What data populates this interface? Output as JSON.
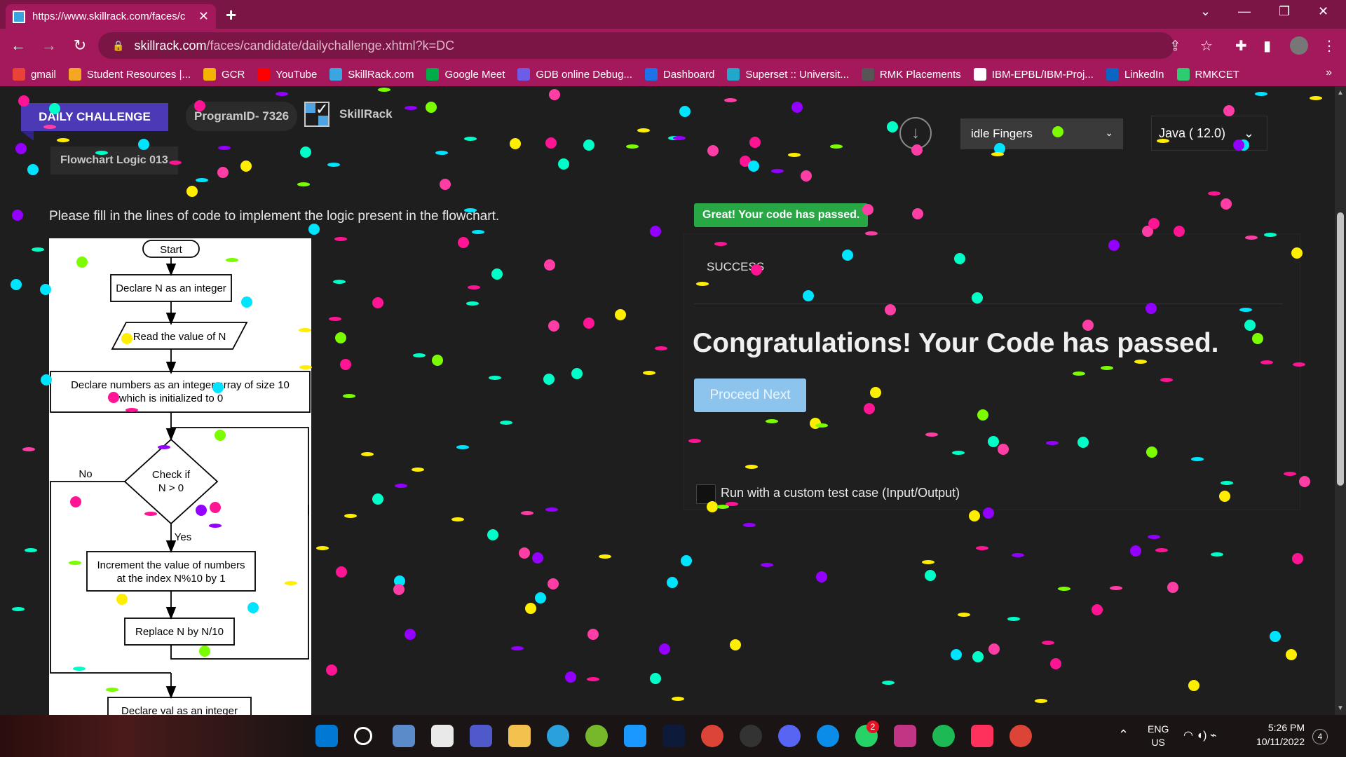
{
  "browser": {
    "tab_title": "https://www.skillrack.com/faces/c",
    "url_host": "skillrack.com",
    "url_path": "/faces/candidate/dailychallenge.xhtml?k=DC",
    "bookmarks": [
      {
        "label": "gmail",
        "icon": "gmail-icon",
        "color": "#ea4335"
      },
      {
        "label": "Student Resources |...",
        "icon": "student-resources-icon",
        "color": "#f5a623"
      },
      {
        "label": "GCR",
        "icon": "classroom-icon",
        "color": "#f4b400"
      },
      {
        "label": "YouTube",
        "icon": "youtube-icon",
        "color": "#ff0000"
      },
      {
        "label": "SkillRack.com",
        "icon": "skillrack-icon",
        "color": "#3aa6e0"
      },
      {
        "label": "Google Meet",
        "icon": "meet-icon",
        "color": "#00ac47"
      },
      {
        "label": "GDB online Debug...",
        "icon": "gdb-icon",
        "color": "#6c5ce7"
      },
      {
        "label": "Dashboard",
        "icon": "dashboard-icon",
        "color": "#1a73e8"
      },
      {
        "label": "Superset :: Universit...",
        "icon": "superset-icon",
        "color": "#20a7c9"
      },
      {
        "label": "RMK Placements",
        "icon": "rmk-icon",
        "color": "#555555"
      },
      {
        "label": "IBM-EPBL/IBM-Proj...",
        "icon": "github-icon",
        "color": "#ffffff"
      },
      {
        "label": "LinkedIn",
        "icon": "linkedin-icon",
        "color": "#0a66c2"
      },
      {
        "label": "RMKCET",
        "icon": "rmkcet-icon",
        "color": "#2ecc71"
      }
    ],
    "more": "»"
  },
  "header": {
    "badge": "DAILY CHALLENGE",
    "program_id": "ProgramID- 7326",
    "logo_text": "SkillRack",
    "subtitle": "Flowchart Logic 013"
  },
  "instructions": "Please fill in the lines of code to implement the logic present in the flowchart.",
  "flowchart": {
    "start": "Start",
    "step1": "Declare N as an integer",
    "step2": "Read the value of N",
    "step3_line1": "Declare numbers as an integer array of size 10",
    "step3_line2": "which is initialized to 0",
    "decision_line1": "Check if",
    "decision_line2": "N > 0",
    "no_label": "No",
    "yes_label": "Yes",
    "step4_line1": "Increment the value of numbers",
    "step4_line2": "at the index N%10 by 1",
    "step5": "Replace N by N/10",
    "step6": "Declare val as an integer"
  },
  "controls": {
    "theme": "idle Fingers",
    "language": "Java ( 12.0)"
  },
  "result": {
    "badge": "Great! Your code has passed.",
    "status": "SUCCESS",
    "congrats": "Congratulations! Your Code has passed.",
    "proceed": "Proceed Next",
    "custom_label": "Run with a custom test case (Input/Output)"
  },
  "taskbar": {
    "lang_top": "ENG",
    "lang_bottom": "US",
    "time": "5:26 PM",
    "date": "10/11/2022",
    "notifications": "4",
    "whatsapp_badge": "2"
  },
  "colors": {
    "browser_accent": "#a3195b",
    "badge_purple": "#4b39b6",
    "success_green": "#28a745",
    "proceed_blue": "#8dc4ee"
  }
}
